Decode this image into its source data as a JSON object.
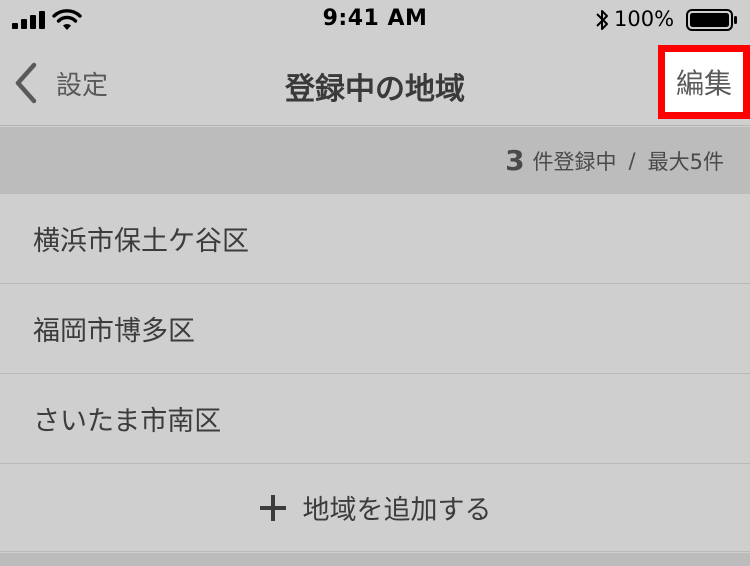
{
  "status_bar": {
    "time": "9:41 AM",
    "battery_percent": "100%"
  },
  "nav": {
    "back_label": "設定",
    "title": "登録中の地域",
    "edit_label": "編集"
  },
  "count_header": {
    "count": "3",
    "count_suffix": "件登録中",
    "separator": "/",
    "max_label": "最大5件"
  },
  "regions": [
    {
      "label": "横浜市保土ケ谷区"
    },
    {
      "label": "福岡市博多区"
    },
    {
      "label": "さいたま市南区"
    }
  ],
  "add_region": {
    "label": "地域を追加する"
  },
  "colors": {
    "background": "#cfcfcf",
    "header_band": "#bcbcbc",
    "highlight_border": "#ff0000"
  }
}
